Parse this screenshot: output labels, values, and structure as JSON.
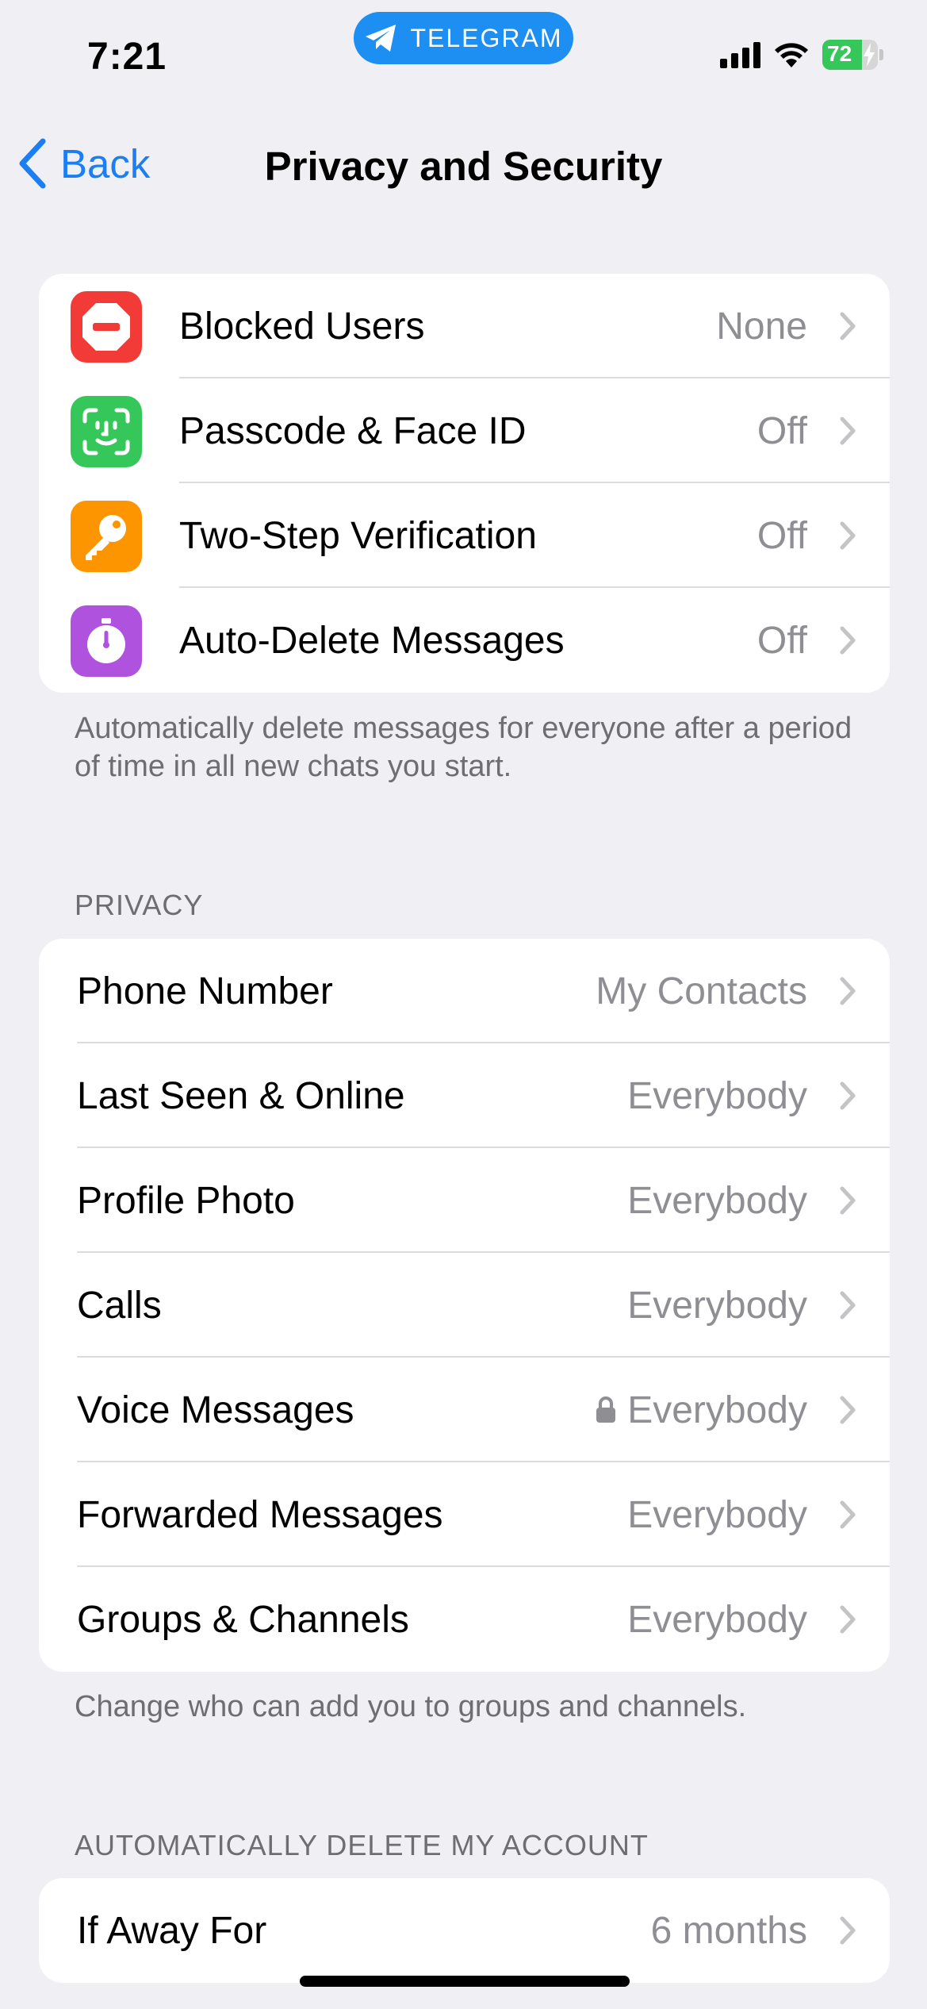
{
  "status_bar": {
    "time": "7:21",
    "app_pill": "TELEGRAM",
    "battery": "72",
    "battery_level": 0.72
  },
  "nav": {
    "back_label": "Back",
    "title": "Privacy and Security"
  },
  "security": {
    "items": [
      {
        "label": "Blocked Users",
        "value": "None",
        "icon": "no-entry-icon",
        "color": "#f23b36"
      },
      {
        "label": "Passcode & Face ID",
        "value": "Off",
        "icon": "face-id-icon",
        "color": "#35c759"
      },
      {
        "label": "Two-Step Verification",
        "value": "Off",
        "icon": "key-icon",
        "color": "#fd9500"
      },
      {
        "label": "Auto-Delete Messages",
        "value": "Off",
        "icon": "timer-icon",
        "color": "#af52de"
      }
    ],
    "footer": "Automatically delete messages for everyone after a period of time in all new chats you start."
  },
  "privacy": {
    "header": "PRIVACY",
    "items": [
      {
        "label": "Phone Number",
        "value": "My Contacts"
      },
      {
        "label": "Last Seen & Online",
        "value": "Everybody"
      },
      {
        "label": "Profile Photo",
        "value": "Everybody"
      },
      {
        "label": "Calls",
        "value": "Everybody"
      },
      {
        "label": "Voice Messages",
        "value": "Everybody",
        "locked": true
      },
      {
        "label": "Forwarded Messages",
        "value": "Everybody"
      },
      {
        "label": "Groups & Channels",
        "value": "Everybody"
      }
    ],
    "footer": "Change who can add you to groups and channels."
  },
  "account": {
    "header": "AUTOMATICALLY DELETE MY ACCOUNT",
    "items": [
      {
        "label": "If Away For",
        "value": "6 months"
      }
    ]
  },
  "colors": {
    "accent": "#1b7ef2",
    "background": "#efeff4",
    "secondary_text": "#8e8e93"
  }
}
